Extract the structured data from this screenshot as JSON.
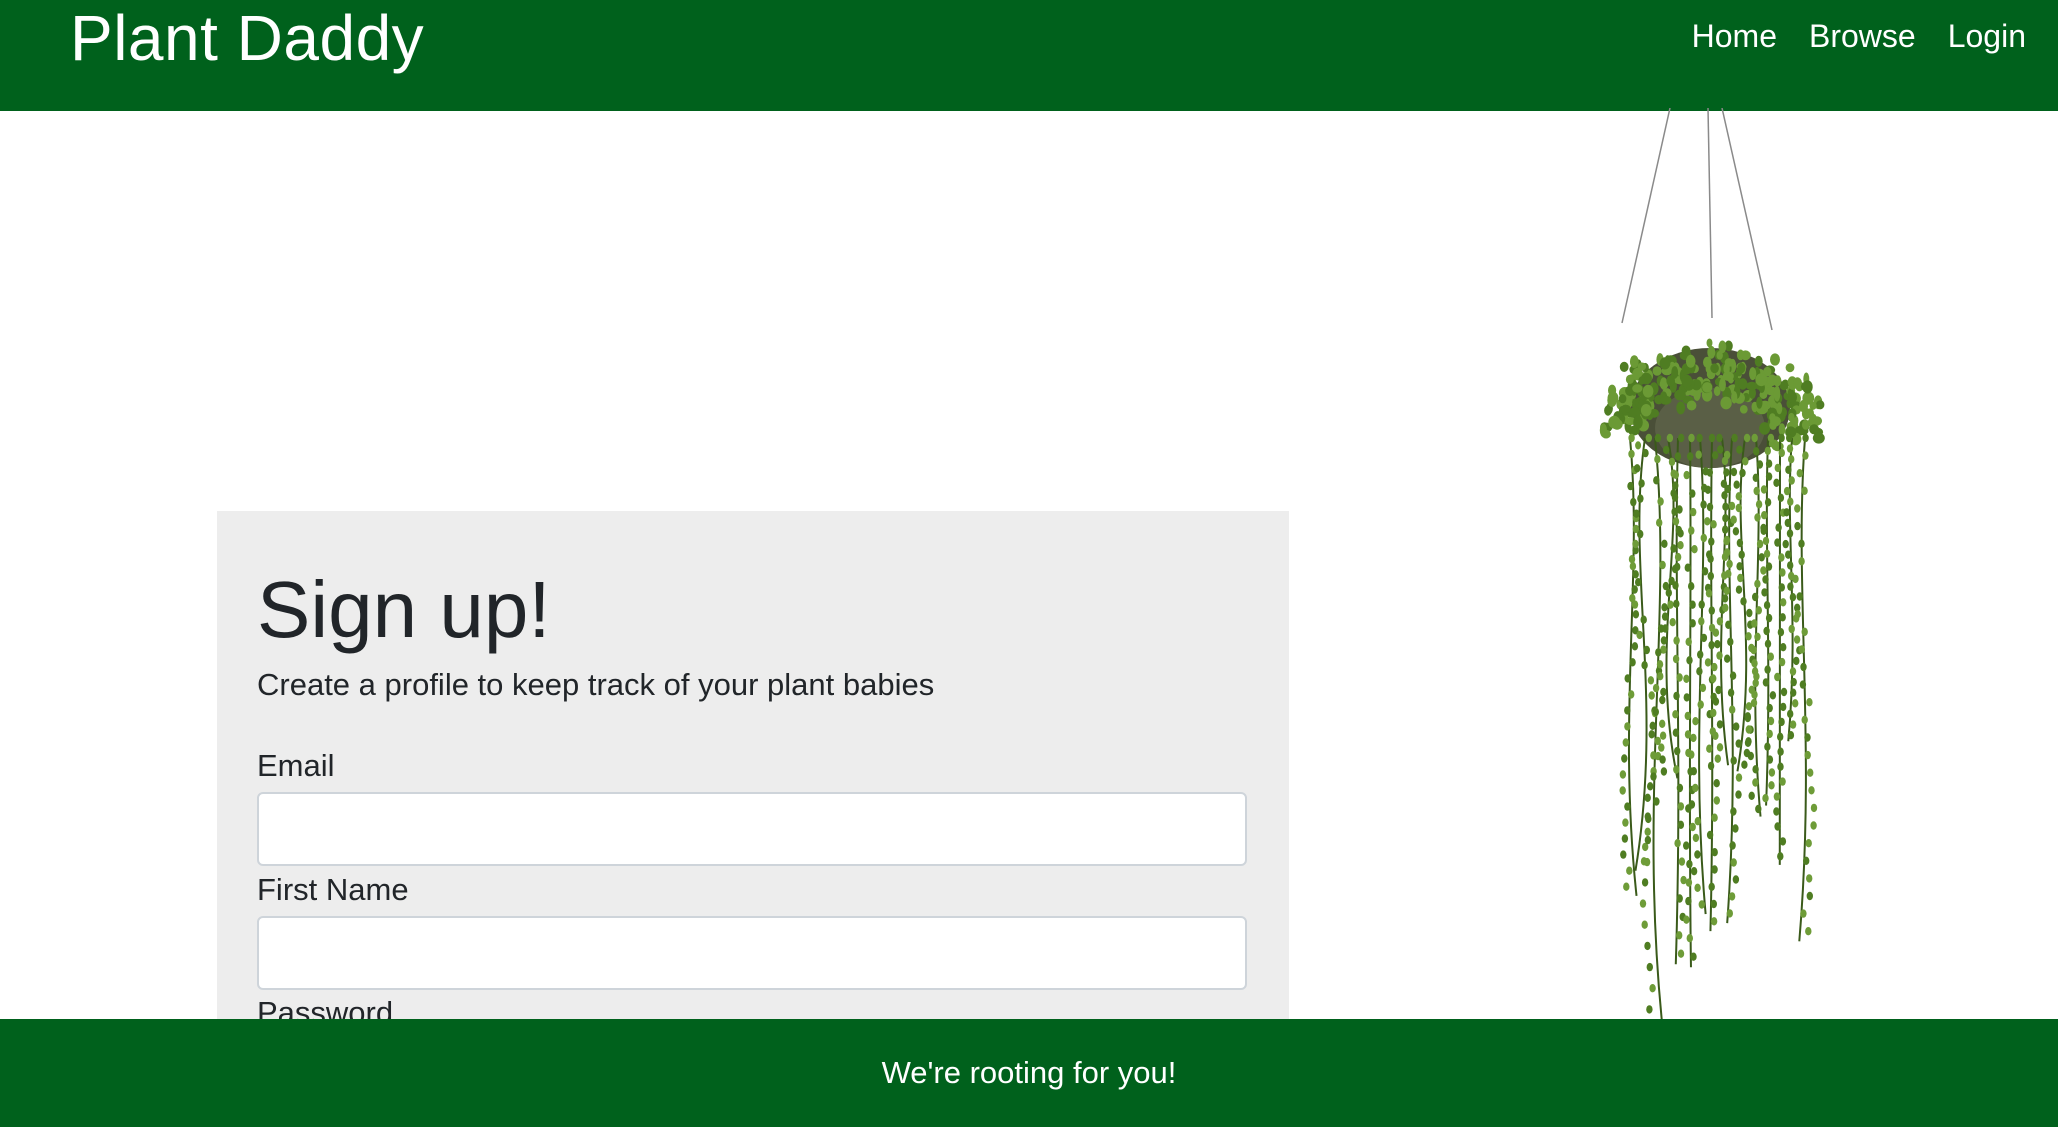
{
  "navbar": {
    "brand": "Plant Daddy",
    "links": [
      "Home",
      "Browse",
      "Login"
    ]
  },
  "signup": {
    "title": "Sign up!",
    "subtitle": "Create a profile to keep track of your plant babies",
    "fields": [
      {
        "label": "Email",
        "value": ""
      },
      {
        "label": "First Name",
        "value": ""
      },
      {
        "label": "Password",
        "value": ""
      }
    ]
  },
  "footer": {
    "text": "We're rooting for you!"
  },
  "colors": {
    "primary_green": "#00611c",
    "card_bg": "#ededed"
  },
  "icons": {
    "plant_image": "hanging-string-of-pearls-plant"
  }
}
